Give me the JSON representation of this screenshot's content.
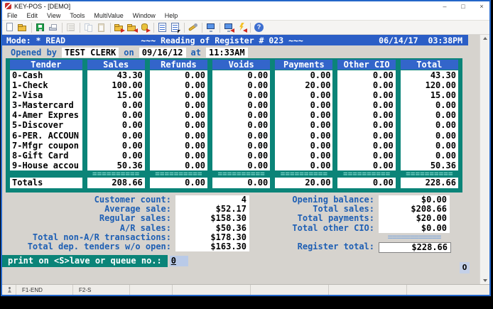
{
  "window": {
    "title": "KEY-POS - [DEMO]",
    "controls": {
      "minimize": "–",
      "maximize": "□",
      "close": "×"
    }
  },
  "menu": [
    "File",
    "Edit",
    "View",
    "Tools",
    "MultiValue",
    "Window",
    "Help"
  ],
  "toolbar": {
    "icons": [
      "new-document",
      "open-folder",
      "save",
      "print",
      "character-map",
      "copy",
      "paste",
      "export-folder",
      "import-folder",
      "database-export",
      "list-view",
      "form-view",
      "settings-wrench",
      "monitor",
      "disconnect-session",
      "quick-connect",
      "help"
    ],
    "help_glyph": "?"
  },
  "mode_bar": {
    "mode": "Mode: * READ",
    "title": "~~~ Reading of Register # 023 ~~~",
    "date": "06/14/17",
    "time": "03:38PM"
  },
  "opened_line": {
    "label_opened": "Opened by",
    "clerk": "TEST CLERK",
    "label_on": "on",
    "date": "09/16/12",
    "label_at": "at",
    "time": "11:33AM"
  },
  "table": {
    "dashes": "==========",
    "columns": [
      {
        "header": "Tender",
        "cells": [
          "0-Cash",
          "1-Check",
          "2-Visa",
          "3-Mastercard",
          "4-Amer Expres",
          "5-Discover",
          "6-PER. ACCOUN",
          "7-Mfgr coupon",
          "8-Gift Card",
          "9-House accou"
        ],
        "total": "Totals"
      },
      {
        "header": "Sales",
        "cells": [
          "43.30",
          "100.00",
          "15.00",
          "0.00",
          "0.00",
          "0.00",
          "0.00",
          "0.00",
          "0.00",
          "50.36"
        ],
        "total": "208.66"
      },
      {
        "header": "Refunds",
        "cells": [
          "0.00",
          "0.00",
          "0.00",
          "0.00",
          "0.00",
          "0.00",
          "0.00",
          "0.00",
          "0.00",
          "0.00"
        ],
        "total": "0.00"
      },
      {
        "header": "Voids",
        "cells": [
          "0.00",
          "0.00",
          "0.00",
          "0.00",
          "0.00",
          "0.00",
          "0.00",
          "0.00",
          "0.00",
          "0.00"
        ],
        "total": "0.00"
      },
      {
        "header": "Payments",
        "cells": [
          "0.00",
          "20.00",
          "0.00",
          "0.00",
          "0.00",
          "0.00",
          "0.00",
          "0.00",
          "0.00",
          "0.00"
        ],
        "total": "20.00"
      },
      {
        "header": "Other CIO",
        "cells": [
          "0.00",
          "0.00",
          "0.00",
          "0.00",
          "0.00",
          "0.00",
          "0.00",
          "0.00",
          "0.00",
          "0.00"
        ],
        "total": "0.00"
      },
      {
        "header": "Total",
        "cells": [
          "43.30",
          "120.00",
          "15.00",
          "0.00",
          "0.00",
          "0.00",
          "0.00",
          "0.00",
          "0.00",
          "50.36"
        ],
        "total": "228.66"
      }
    ]
  },
  "summary": {
    "rows": [
      {
        "l_label": "Customer count:",
        "l_value": "4",
        "r_label": "Opening balance:",
        "r_value": "$0.00"
      },
      {
        "l_label": "Average sale:",
        "l_value": "$52.17",
        "r_label": "Total sales:",
        "r_value": "$208.66"
      },
      {
        "l_label": "Regular sales:",
        "l_value": "$158.30",
        "r_label": "Total payments:",
        "r_value": "$20.00"
      },
      {
        "l_label": "A/R sales:",
        "l_value": "$50.36",
        "r_label": "Total other CIO:",
        "r_value": "$0.00"
      },
      {
        "l_label": "Total non-A/R transactions:",
        "l_value": "$178.30",
        "r_separator": "============"
      },
      {
        "l_label": "Total dep. tenders w/o open:",
        "l_value": "$163.30",
        "r_label": "Register total:",
        "r_value": "$228.66"
      }
    ]
  },
  "prompt": {
    "label": "print on <S>lave or queue no.:",
    "value": "0"
  },
  "echo_box": {
    "value": "O"
  },
  "status_bar": {
    "fn_keys": [
      "F1-END",
      "F2-S"
    ]
  },
  "colors": {
    "teal_panel": "#0B8478",
    "header_blue": "#3365CA",
    "mode_bar_blue": "#2B5EC6",
    "label_blue": "#1E5FB4",
    "window_border": "#2365C8",
    "input_blue": "#B9CAE8",
    "client_gray": "#D6D3CE"
  }
}
